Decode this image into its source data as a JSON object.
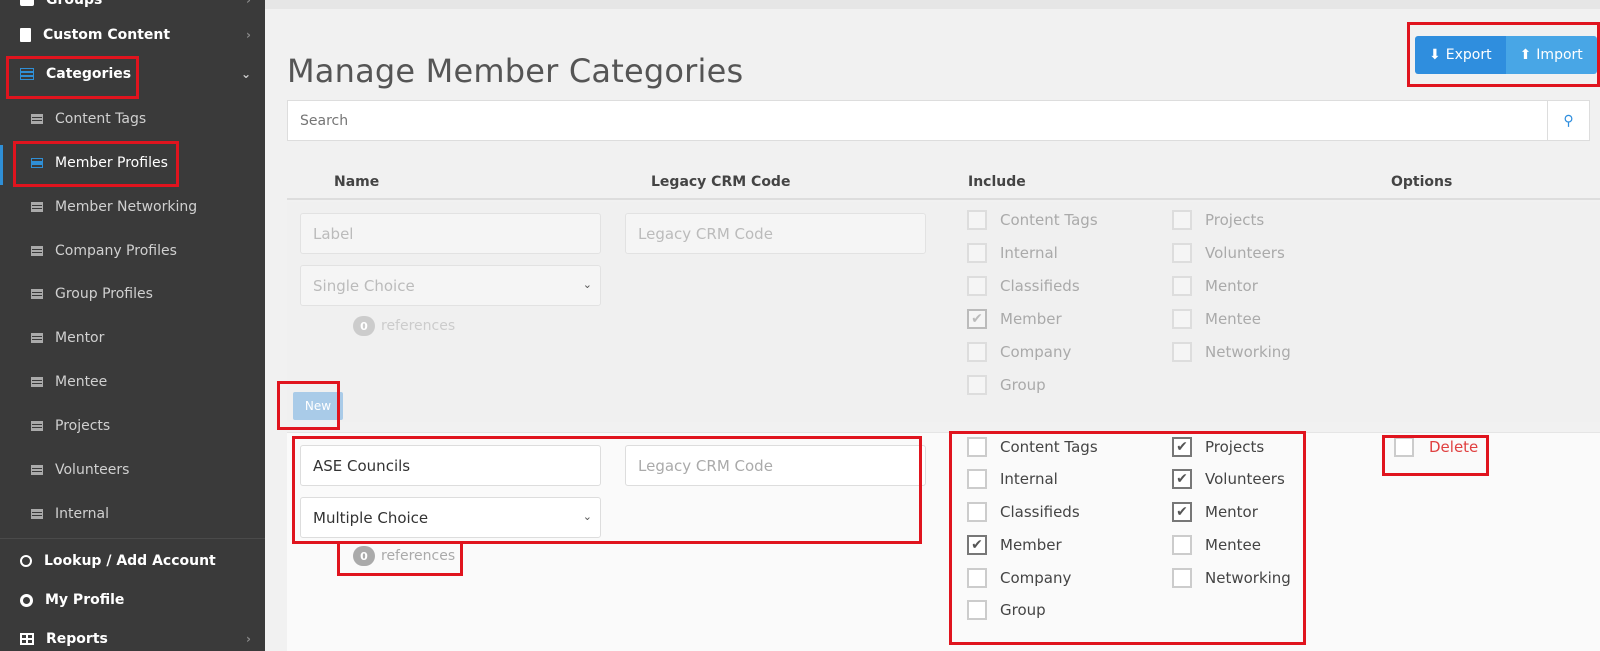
{
  "sidebar": {
    "items": [
      {
        "label": "Groups",
        "type": "top"
      },
      {
        "label": "Custom Content",
        "type": "top"
      },
      {
        "label": "Categories",
        "type": "top"
      },
      {
        "label": "Content Tags",
        "type": "sub"
      },
      {
        "label": "Member Profiles",
        "type": "sub"
      },
      {
        "label": "Member Networking",
        "type": "sub"
      },
      {
        "label": "Company Profiles",
        "type": "sub"
      },
      {
        "label": "Group Profiles",
        "type": "sub"
      },
      {
        "label": "Mentor",
        "type": "sub"
      },
      {
        "label": "Mentee",
        "type": "sub"
      },
      {
        "label": "Projects",
        "type": "sub"
      },
      {
        "label": "Volunteers",
        "type": "sub"
      },
      {
        "label": "Internal",
        "type": "sub"
      },
      {
        "label": "Lookup / Add Account",
        "type": "top"
      },
      {
        "label": "My Profile",
        "type": "top"
      },
      {
        "label": "Reports",
        "type": "top"
      }
    ]
  },
  "page": {
    "title": "Manage Member Categories",
    "export_label": "Export",
    "import_label": "Import",
    "search_placeholder": "Search"
  },
  "table": {
    "headers": {
      "name": "Name",
      "legacy": "Legacy CRM Code",
      "include": "Include",
      "options": "Options"
    }
  },
  "new_row": {
    "label_placeholder": "Label",
    "legacy_placeholder": "Legacy CRM Code",
    "select_value": "Single Choice",
    "ref_count": "0",
    "ref_label": "references",
    "new_button": "New",
    "include_left": [
      {
        "label": "Content Tags",
        "checked": false
      },
      {
        "label": "Internal",
        "checked": false
      },
      {
        "label": "Classifieds",
        "checked": false
      },
      {
        "label": "Member",
        "checked": true
      },
      {
        "label": "Company",
        "checked": false
      },
      {
        "label": "Group",
        "checked": false
      }
    ],
    "include_right": [
      {
        "label": "Projects",
        "checked": false
      },
      {
        "label": "Volunteers",
        "checked": false
      },
      {
        "label": "Mentor",
        "checked": false
      },
      {
        "label": "Mentee",
        "checked": false
      },
      {
        "label": "Networking",
        "checked": false
      }
    ]
  },
  "ase_row": {
    "name_value": "ASE Councils",
    "legacy_placeholder": "Legacy CRM Code",
    "select_value": "Multiple Choice",
    "ref_count": "0",
    "ref_label": "references",
    "delete_label": "Delete",
    "include_left": [
      {
        "label": "Content Tags",
        "checked": false
      },
      {
        "label": "Internal",
        "checked": false
      },
      {
        "label": "Classifieds",
        "checked": false
      },
      {
        "label": "Member",
        "checked": true
      },
      {
        "label": "Company",
        "checked": false
      },
      {
        "label": "Group",
        "checked": false
      }
    ],
    "include_right": [
      {
        "label": "Projects",
        "checked": true
      },
      {
        "label": "Volunteers",
        "checked": true
      },
      {
        "label": "Mentor",
        "checked": true
      },
      {
        "label": "Mentee",
        "checked": false
      },
      {
        "label": "Networking",
        "checked": false
      }
    ]
  },
  "colors": {
    "accent": "#2f8ede",
    "sidebar_bg": "#3a3a3a",
    "highlight": "#e0141e",
    "delete": "#e04040"
  }
}
